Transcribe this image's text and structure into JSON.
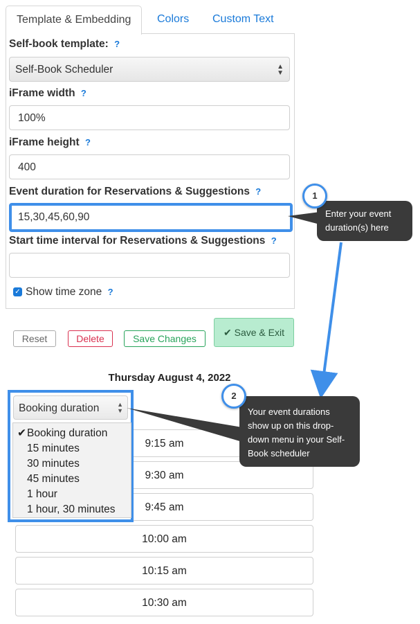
{
  "tabs": [
    {
      "label": "Template & Embedding",
      "active": true
    },
    {
      "label": "Colors",
      "active": false
    },
    {
      "label": "Custom Text",
      "active": false
    }
  ],
  "form": {
    "template_label": "Self-book template:",
    "template_value": "Self-Book Scheduler",
    "iframe_width_label": "iFrame width",
    "iframe_width_value": "100%",
    "iframe_height_label": "iFrame height",
    "iframe_height_value": "400",
    "duration_label": "Event duration for Reservations & Suggestions",
    "duration_value": "15,30,45,60,90",
    "interval_label": "Start time interval for Reservations & Suggestions",
    "interval_value": "",
    "timezone_label": "Show time zone",
    "timezone_checked": true,
    "help_mark": "?"
  },
  "buttons": {
    "reset": "Reset",
    "delete": "Delete",
    "save_changes": "Save Changes",
    "save_exit": "Save & Exit",
    "save_exit_icon": "✔"
  },
  "schedule": {
    "date": "Thursday August 4, 2022",
    "dropdown_value": "Booking duration",
    "dropdown_options": [
      "Booking duration",
      "15 minutes",
      "30 minutes",
      "45 minutes",
      "1 hour",
      "1 hour, 30 minutes"
    ],
    "check_mark": "✔",
    "slots": [
      "9:15 am",
      "9:30 am",
      "9:45 am",
      "10:00 am",
      "10:15 am",
      "10:30 am"
    ]
  },
  "annotations": {
    "badge1": "1",
    "callout1": "Enter your event duration(s) here",
    "badge2": "2",
    "callout2": "Your event durations show up on this drop-down menu in your Self-Book scheduler"
  },
  "colors": {
    "link_blue": "#1a7ad9",
    "highlight_blue": "#3f8fe9",
    "callout_bg": "#3a3a3a",
    "delete_red": "#d9304f",
    "save_green": "#27a35a",
    "save_exit_bg": "#b8ecd0"
  }
}
